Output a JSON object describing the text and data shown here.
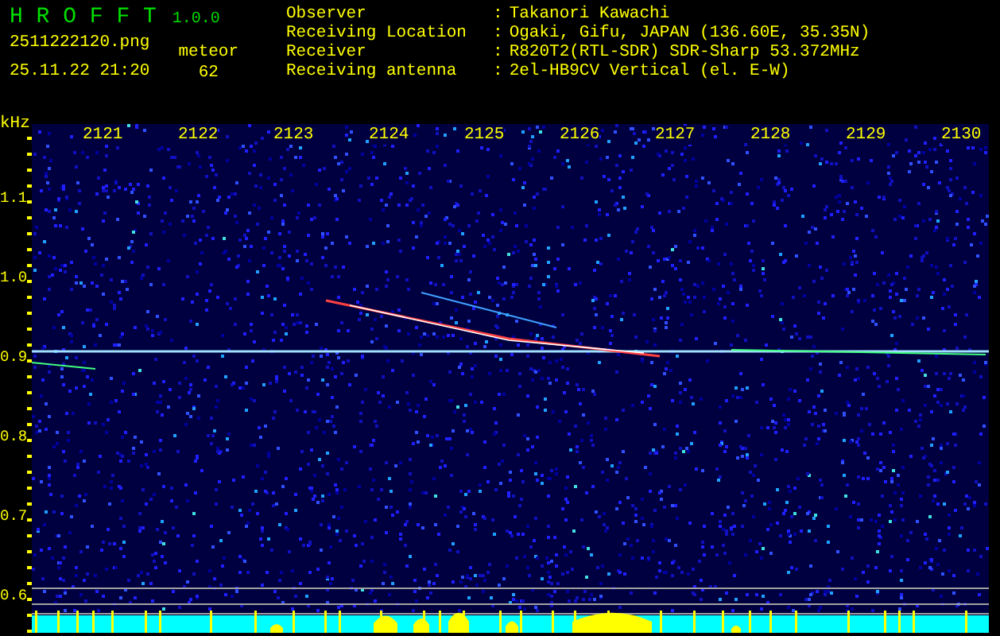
{
  "app": {
    "name": "H R O F F T",
    "version": "1.0.0"
  },
  "file": "2511222120.png",
  "datetime": "25.11.22 21:20",
  "count_label": "meteor",
  "count": "62",
  "info": [
    {
      "label": "Observer",
      "separator": ":",
      "value": "Takanori Kawachi"
    },
    {
      "label": "Receiving Location",
      "separator": ":",
      "value": "Ogaki, Gifu, JAPAN (136.60E, 35.35N)"
    },
    {
      "label": "Receiver",
      "separator": ":",
      "value": "R820T2(RTL-SDR) SDR-Sharp 53.372MHz"
    },
    {
      "label": "Receiving antenna",
      "separator": ":",
      "value": "2el-HB9CV Vertical (el. E-W)"
    }
  ],
  "spectrogram": {
    "unit": "kHz",
    "x_labels": [
      "2121",
      "2122",
      "2123",
      "2124",
      "2125",
      "2126",
      "2127",
      "2128",
      "2129",
      "2130"
    ],
    "y_labels": [
      "1.1",
      "1.0",
      "0.9",
      "0.8",
      "0.7",
      "0.6"
    ]
  }
}
